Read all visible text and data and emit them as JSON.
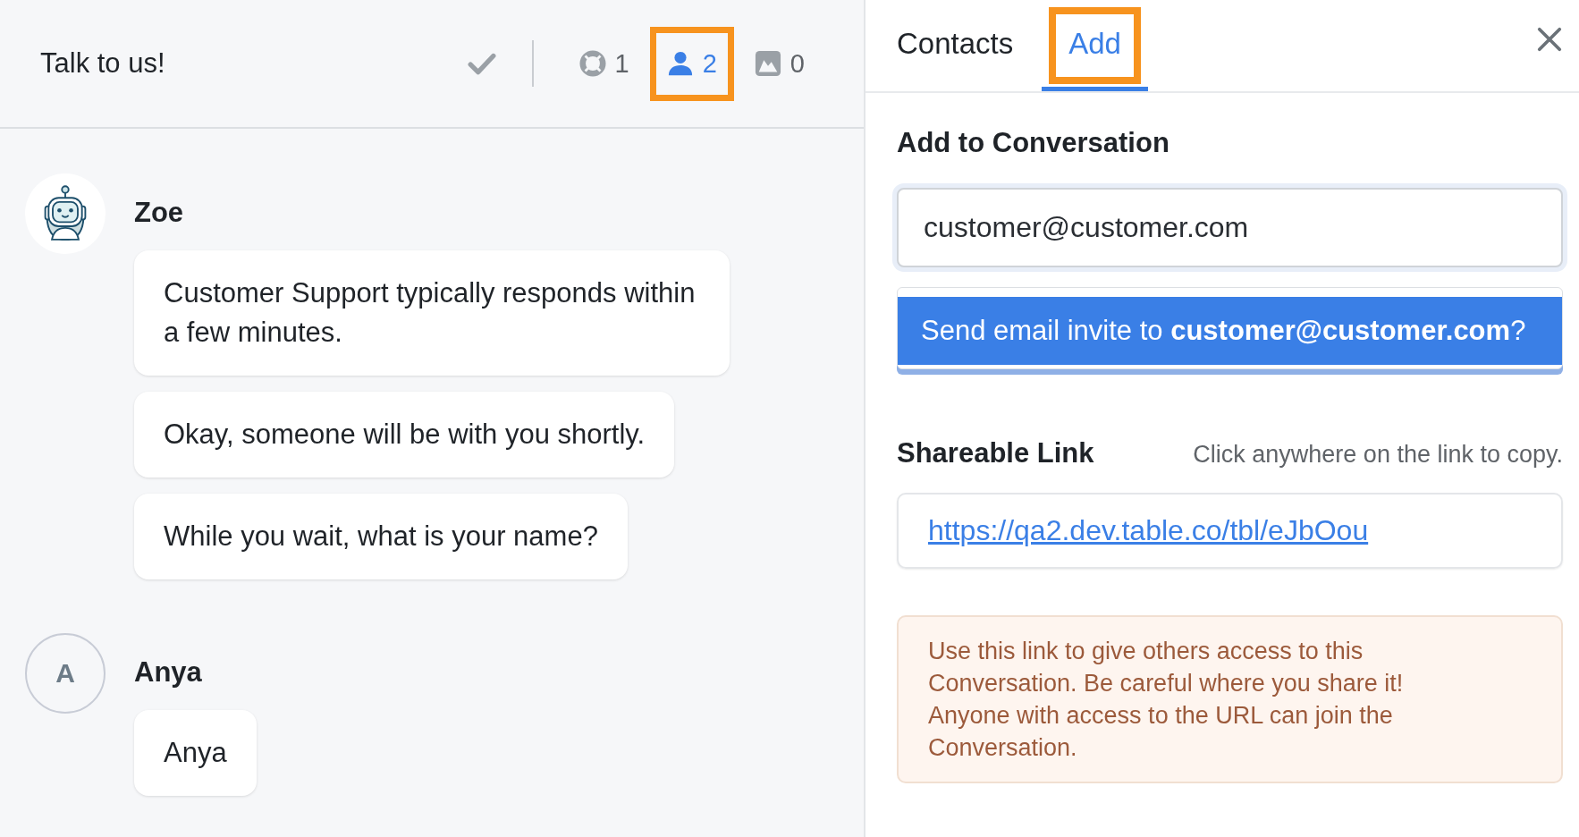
{
  "chat": {
    "title": "Talk to us!",
    "counters": [
      {
        "kind": "support",
        "count": "1",
        "selected": false,
        "highlighted": false
      },
      {
        "kind": "people",
        "count": "2",
        "selected": true,
        "highlighted": true
      },
      {
        "kind": "media",
        "count": "0",
        "selected": false,
        "highlighted": false
      }
    ],
    "messages": [
      {
        "author": "Zoe",
        "avatar": {
          "kind": "bot"
        },
        "bubbles": [
          "Customer Support typically responds within a few minutes.",
          "Okay, someone will be with you shortly.",
          "While you wait, what is your name?"
        ]
      },
      {
        "author": "Anya",
        "avatar": {
          "kind": "initial",
          "letter": "A"
        },
        "bubbles": [
          "Anya"
        ]
      }
    ]
  },
  "panel": {
    "tabs": [
      {
        "label": "Contacts",
        "selected": false,
        "highlighted": false
      },
      {
        "label": "Add",
        "selected": true,
        "highlighted": true
      }
    ],
    "heading": "Add to Conversation",
    "email_field": {
      "value": "customer@customer.com"
    },
    "suggestion": "Send email invite to **customer@customer.com**?",
    "share_heading": "Shareable Link",
    "share_hint": "Click anywhere on the link to copy.",
    "share_link": "https://qa2.dev.table.co/tbl/eJbOou",
    "notice": "Use this link to give others access to this Conversation. Be careful where you share it! Anyone with access to the URL can join the Conversation."
  }
}
